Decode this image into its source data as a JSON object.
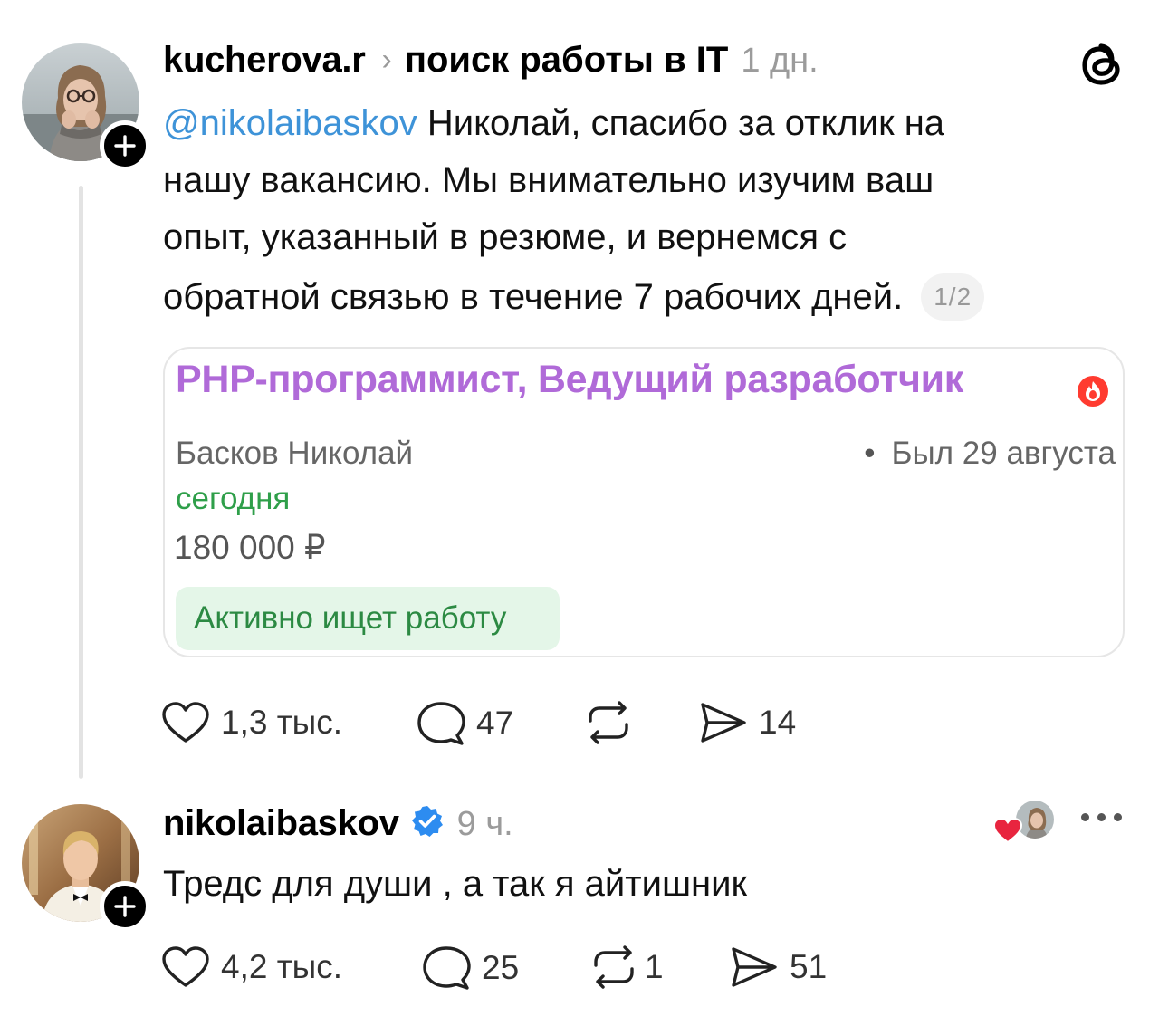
{
  "post1": {
    "username": "kucherova.r",
    "separator": "›",
    "topic": "поиск работы в IT",
    "time": "1 дн.",
    "mention": "@nikolaibaskov",
    "text_lines": [
      " Николай, спасибо за отклик на",
      "нашу вакансию. Мы внимательно изучим ваш",
      "опыт, указанный в резюме, и вернемся с",
      "обратной связью в течение 7 рабочих дней."
    ],
    "page_indicator": "1/2",
    "card": {
      "title": "PHP-программист, Ведущий разработчик",
      "name": "Басков Николай",
      "last_seen": "Был 29 августа",
      "today": "сегодня",
      "salary": "180 000 ₽",
      "status_badge": "Активно ищет работу"
    },
    "actions": {
      "likes": "1,3 тыс.",
      "comments": "47",
      "reposts": "",
      "shares": "14"
    }
  },
  "post2": {
    "username": "nikolaibaskov",
    "time": "9 ч.",
    "text": "Тредс для души , а так я айтишник",
    "actions": {
      "likes": "4,2 тыс.",
      "comments": "25",
      "reposts": "1",
      "shares": "51"
    }
  },
  "colors": {
    "mention": "#3e93d8",
    "card_title": "#b06ad8",
    "today_green": "#2f9f4a",
    "badge_bg": "#e4f6e8",
    "verified": "#2d8cf0",
    "like_heart": "#e8253f",
    "fire": "#ff3b30"
  },
  "icons": [
    "threads-logo-icon",
    "plus-icon",
    "heart-icon",
    "comment-icon",
    "repost-icon",
    "share-icon",
    "verified-icon",
    "fire-icon",
    "more-icon"
  ]
}
